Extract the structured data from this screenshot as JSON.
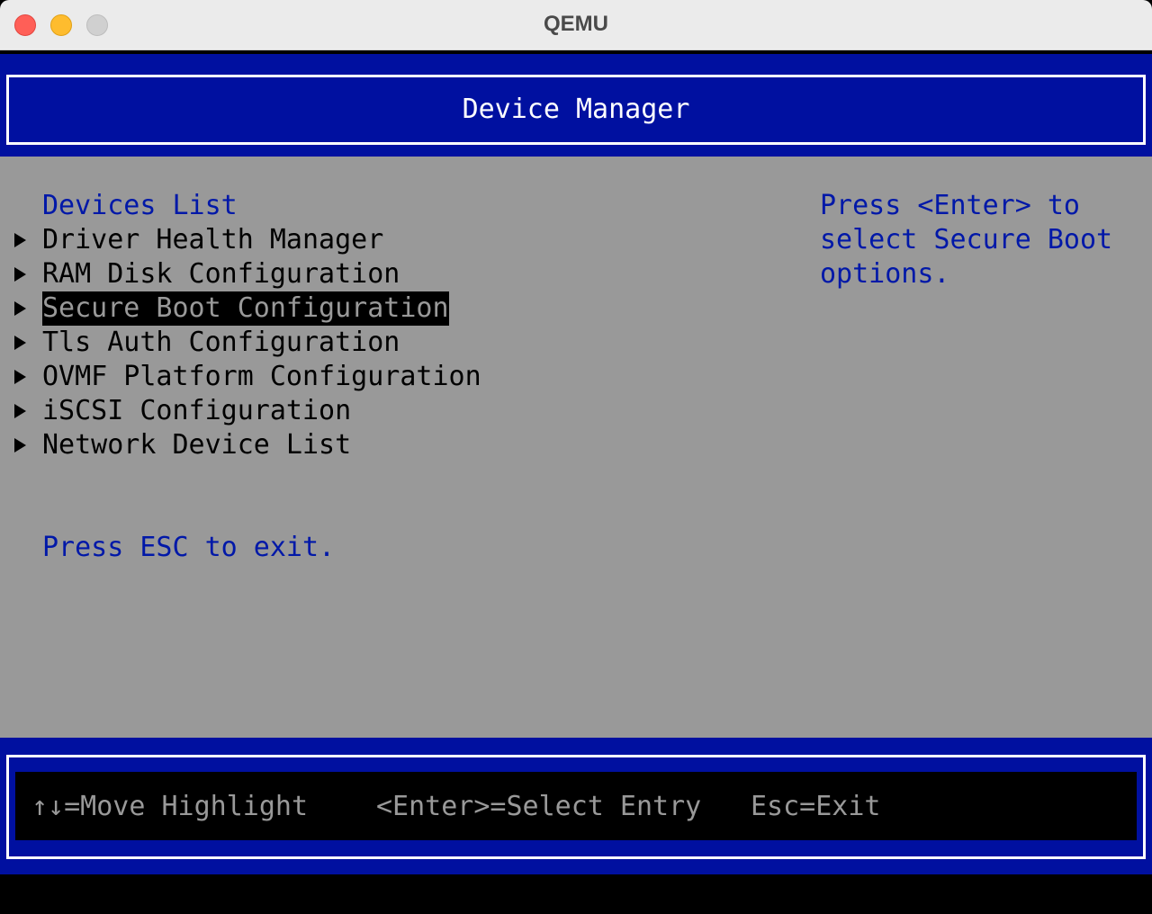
{
  "window": {
    "title": "QEMU"
  },
  "header": {
    "title": "Device Manager"
  },
  "main": {
    "section_label": "Devices List",
    "items": [
      {
        "label": "Driver Health Manager",
        "selected": false
      },
      {
        "label": "RAM Disk Configuration",
        "selected": false
      },
      {
        "label": "Secure Boot Configuration",
        "selected": true
      },
      {
        "label": "Tls Auth Configuration",
        "selected": false
      },
      {
        "label": "OVMF Platform Configuration",
        "selected": false
      },
      {
        "label": "iSCSI Configuration",
        "selected": false
      },
      {
        "label": "Network Device List",
        "selected": false
      }
    ],
    "exit_hint": "Press ESC to exit."
  },
  "help": {
    "lines": [
      "Press <Enter> to",
      "select Secure Boot",
      "options."
    ]
  },
  "footer": {
    "move_hint": "↑↓=Move Highlight",
    "select_hint": "<Enter>=Select Entry",
    "exit_hint": "Esc=Exit"
  },
  "colors": {
    "bios_blue": "#0010a0",
    "body_gray": "#999999",
    "text_blue": "#0018a8",
    "highlight": "#000000"
  },
  "icons": {
    "menu_arrow": "right-triangle-icon"
  }
}
